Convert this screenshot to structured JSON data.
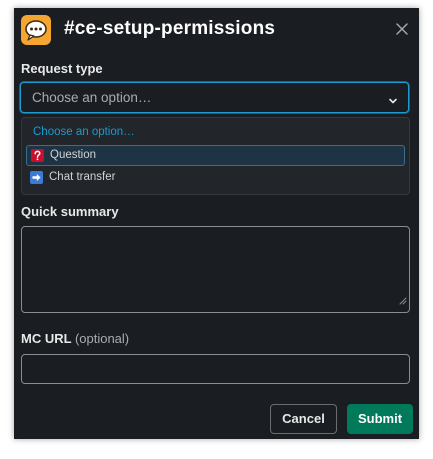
{
  "modal": {
    "title": "#ce-setup-permissions",
    "app_icon": "speech-bubble-icon",
    "close_icon": "close-icon"
  },
  "form": {
    "request_type": {
      "label": "Request type",
      "placeholder": "Choose an option…",
      "options_header": "Choose an option…",
      "options": [
        {
          "label": "Question",
          "icon": "question-mark-icon",
          "highlighted": true
        },
        {
          "label": "Chat transfer",
          "icon": "right-arrow-icon",
          "highlighted": false
        }
      ]
    },
    "quick_summary": {
      "label": "Quick summary",
      "value": ""
    },
    "mc_url": {
      "label": "MC URL",
      "optional_suffix": "(optional)",
      "value": ""
    }
  },
  "actions": {
    "cancel_label": "Cancel",
    "submit_label": "Submit"
  },
  "colors": {
    "modal_bg": "#1a1d21",
    "accent_blue": "#1d9bd1",
    "submit_green": "#007a5a",
    "app_icon_orange": "#f4a630",
    "question_red": "#c8102e",
    "arrow_blue": "#3a7bd5"
  }
}
